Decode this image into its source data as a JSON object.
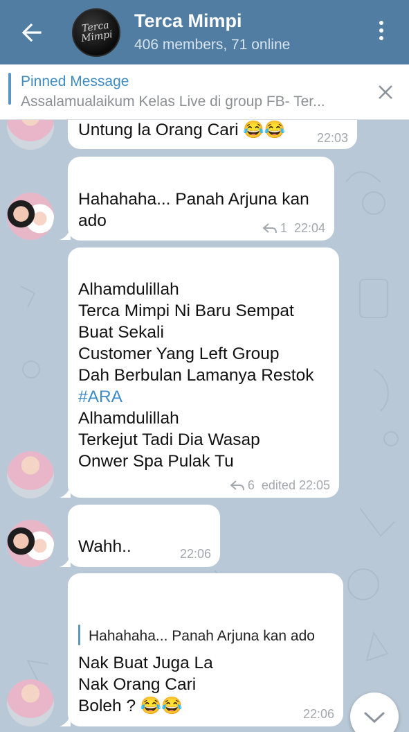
{
  "header": {
    "title": "Terca Mimpi",
    "subtitle": "406 members, 71 online",
    "logo_text": "Terca Mimpi"
  },
  "pinned": {
    "title": "Pinned Message",
    "text": "Assalamualaikum    Kelas Live di group FB- Ter..."
  },
  "messages": [
    {
      "text": "Untung la Orang Cari 😂😂",
      "time": "22:03"
    },
    {
      "text": "Hahahaha... Panah Arjuna kan\nado",
      "reply_count": "1",
      "time": "22:04"
    },
    {
      "lines_before": "Alhamdulillah\nTerca Mimpi Ni Baru Sempat\nBuat Sekali\nCustomer Yang Left Group\nDah Berbulan Lamanya Restok",
      "hashtag": "#ARA",
      "lines_after": "Alhamdulillah\nTerkejut Tadi Dia Wasap\nOnwer Spa Pulak Tu",
      "reply_count": "6",
      "time": "edited 22:05"
    },
    {
      "text": "Wahh..",
      "time": "22:06"
    },
    {
      "quote": "Hahahaha... Panah Arjuna kan ado",
      "text": "Nak Buat Juga La\nNak Orang Cari\nBoleh ? 😂😂",
      "time": "22:06"
    }
  ],
  "colors": {
    "header": "#517da2",
    "accent": "#3e8cc6",
    "chat_bg": "#b9c8d6"
  },
  "icons": [
    "back-arrow-icon",
    "more-vert-icon",
    "close-icon",
    "reply-icon",
    "chevron-down-icon"
  ]
}
